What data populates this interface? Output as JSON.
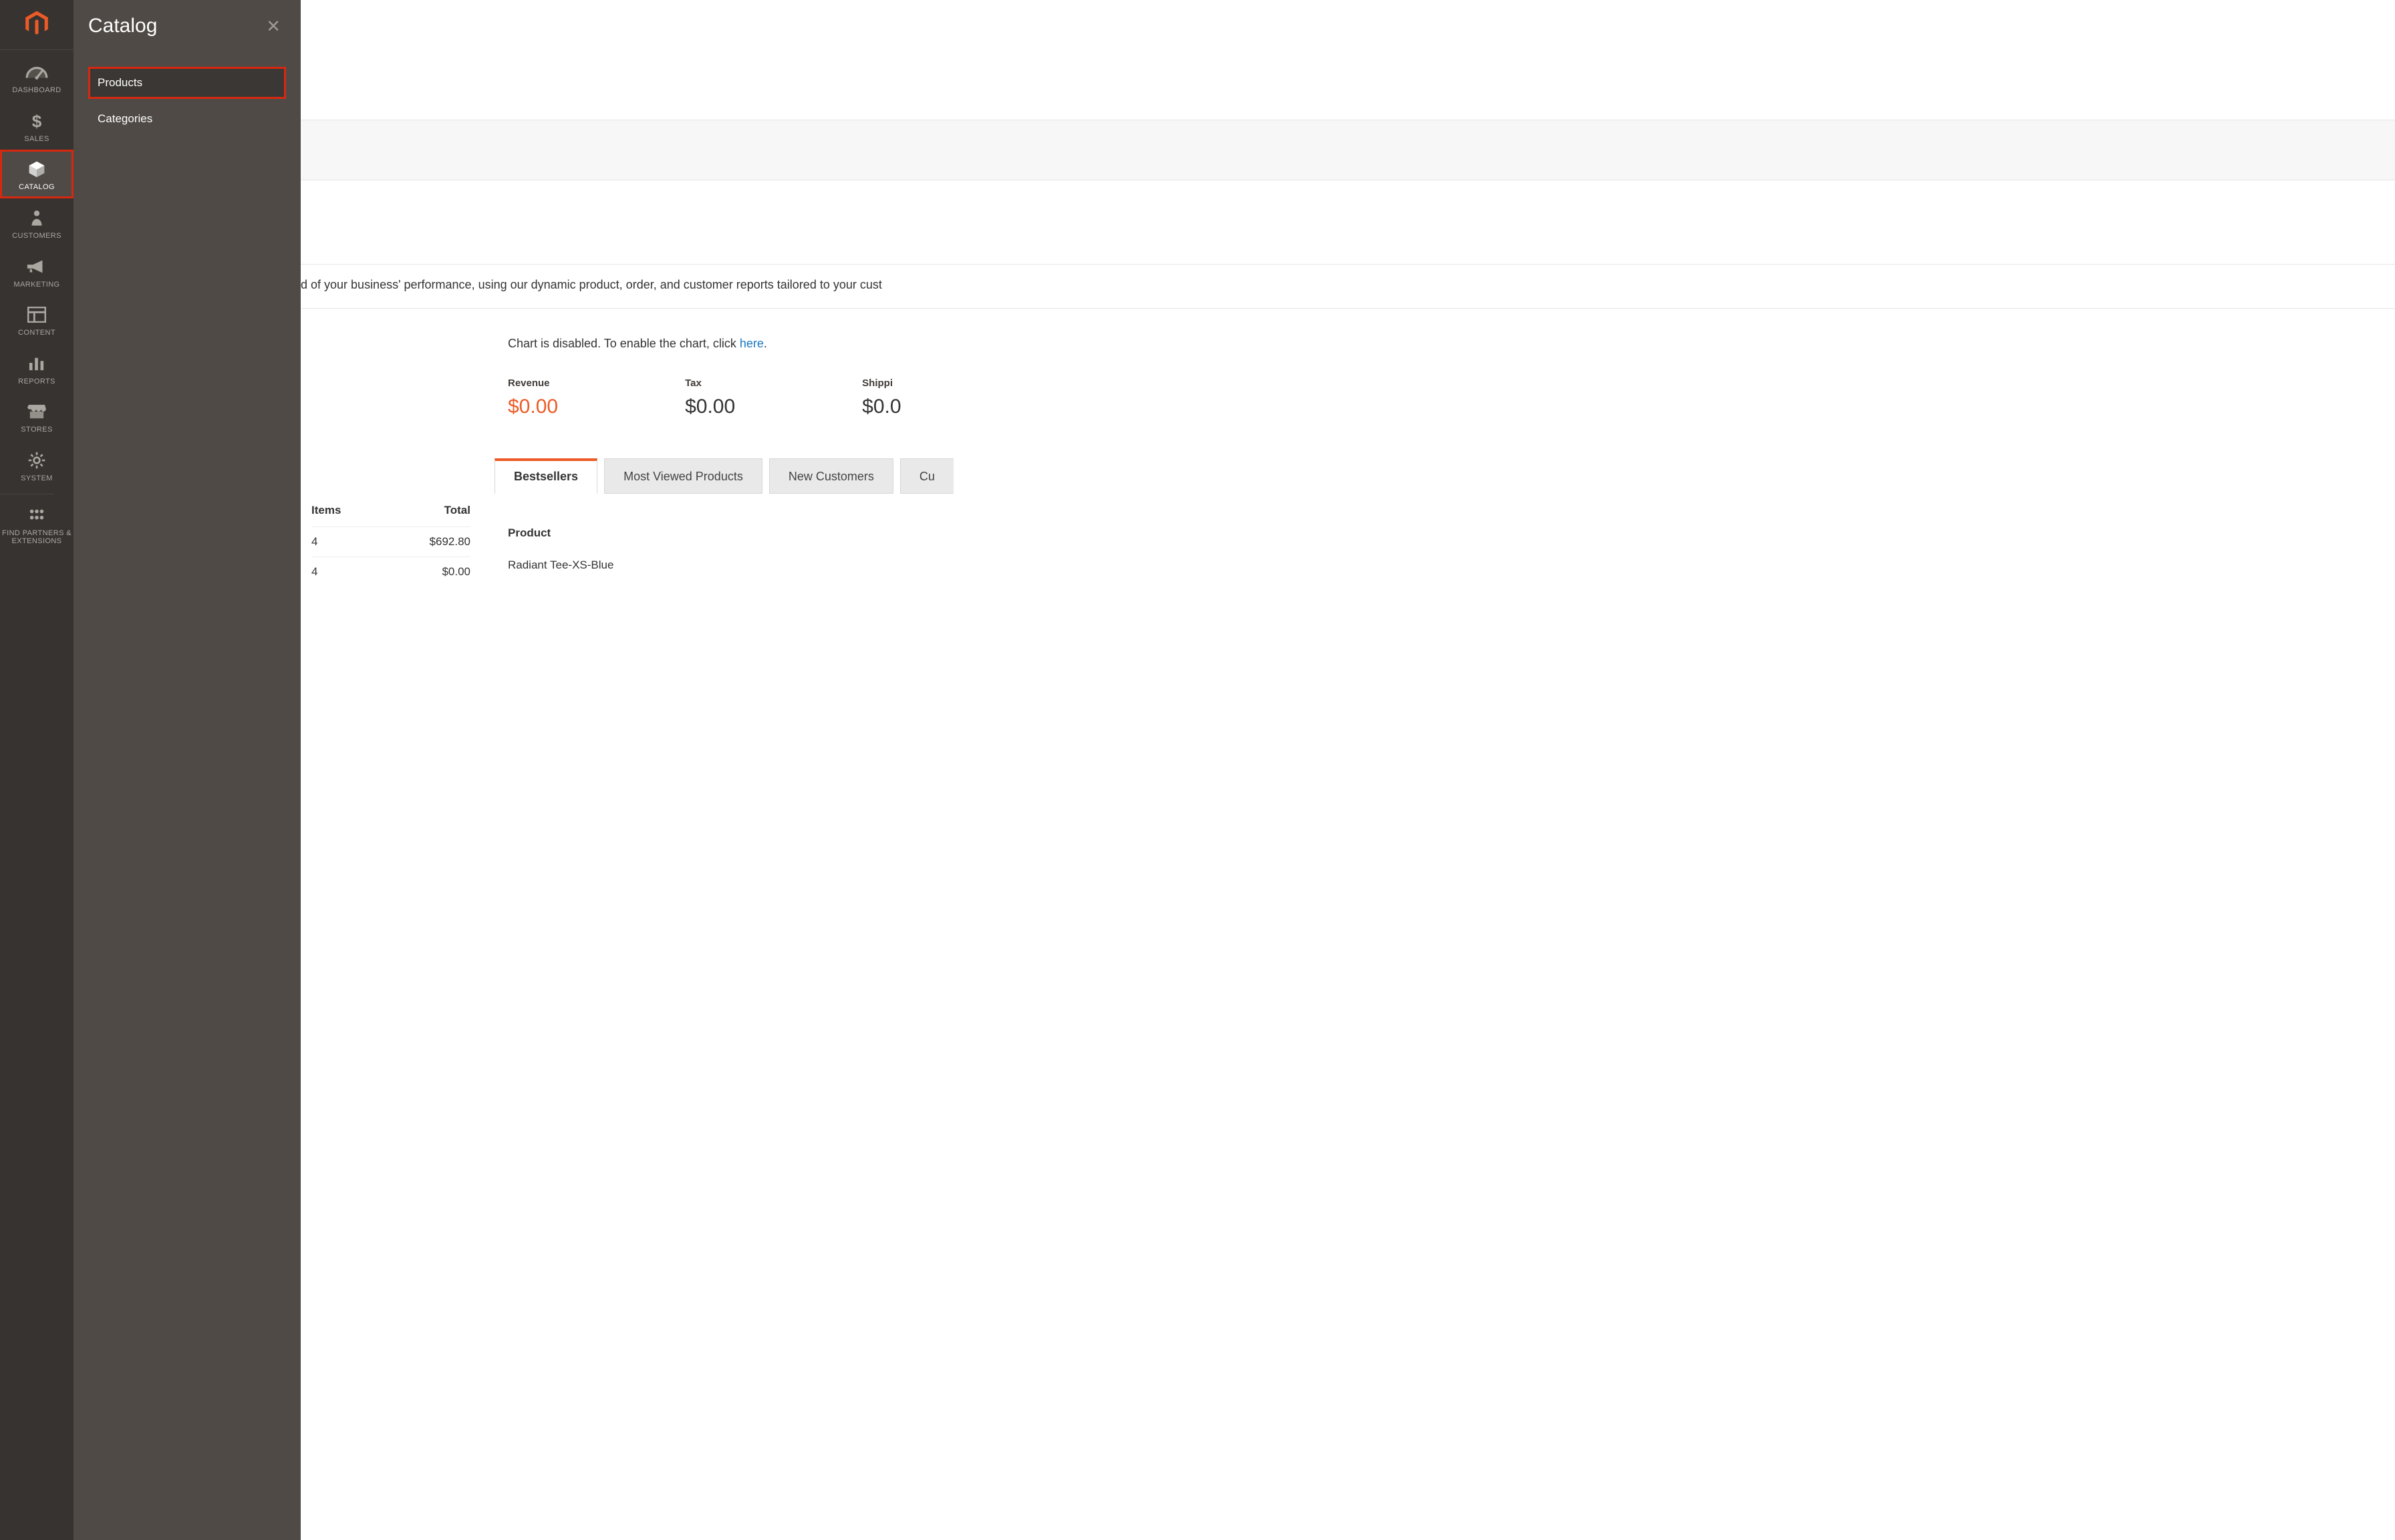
{
  "flyout": {
    "title": "Catalog",
    "items": [
      {
        "label": "Products",
        "active": true
      },
      {
        "label": "Categories",
        "active": false
      }
    ]
  },
  "rail": {
    "items": [
      {
        "id": "dashboard",
        "label": "DASHBOARD",
        "icon": "gauge"
      },
      {
        "id": "sales",
        "label": "SALES",
        "icon": "dollar"
      },
      {
        "id": "catalog",
        "label": "CATALOG",
        "icon": "box",
        "active": true
      },
      {
        "id": "customers",
        "label": "CUSTOMERS",
        "icon": "person"
      },
      {
        "id": "marketing",
        "label": "MARKETING",
        "icon": "megaphone"
      },
      {
        "id": "content",
        "label": "CONTENT",
        "icon": "layout"
      },
      {
        "id": "reports",
        "label": "REPORTS",
        "icon": "bars"
      },
      {
        "id": "stores",
        "label": "STORES",
        "icon": "storefront"
      },
      {
        "id": "system",
        "label": "SYSTEM",
        "icon": "gear"
      },
      {
        "id": "partners",
        "label": "FIND PARTNERS & EXTENSIONS",
        "icon": "blocks"
      }
    ]
  },
  "dashboard": {
    "description_fragment": "d of your business' performance, using our dynamic product, order, and customer reports tailored to your cust",
    "chart_disabled_prefix": "Chart is disabled. To enable the chart, click ",
    "chart_disabled_link": "here",
    "chart_disabled_suffix": ".",
    "metrics": [
      {
        "label": "Revenue",
        "value": "$0.00",
        "accent": true
      },
      {
        "label": "Tax",
        "value": "$0.00"
      },
      {
        "label": "Shippi",
        "value": "$0.0",
        "cut": true
      }
    ],
    "tabs": [
      {
        "label": "Bestsellers",
        "active": true
      },
      {
        "label": "Most Viewed Products"
      },
      {
        "label": "New Customers"
      },
      {
        "label": "Cu",
        "cut": true
      }
    ],
    "orders_table": {
      "headers": [
        "Items",
        "Total"
      ],
      "rows": [
        {
          "items": "4",
          "total": "$692.80"
        },
        {
          "items": "4",
          "total": "$0.00"
        }
      ]
    },
    "products_table": {
      "header": "Product",
      "rows": [
        "Radiant Tee-XS-Blue"
      ]
    }
  }
}
